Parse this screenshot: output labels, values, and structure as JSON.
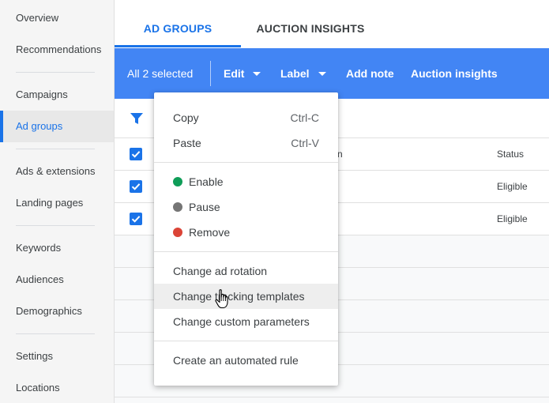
{
  "sidebar": {
    "items": [
      {
        "label": "Overview"
      },
      {
        "label": "Recommendations"
      },
      {
        "label": "Campaigns"
      },
      {
        "label": "Ad groups"
      },
      {
        "label": "Ads & extensions"
      },
      {
        "label": "Landing pages"
      },
      {
        "label": "Keywords"
      },
      {
        "label": "Audiences"
      },
      {
        "label": "Demographics"
      },
      {
        "label": "Settings"
      },
      {
        "label": "Locations"
      }
    ],
    "active_item": "Ad groups"
  },
  "tabs": [
    {
      "label": "AD GROUPS",
      "active": true
    },
    {
      "label": "AUCTION INSIGHTS",
      "active": false
    }
  ],
  "action_bar": {
    "selection_label": "All 2 selected",
    "edit_label": "Edit",
    "label_label": "Label",
    "add_note_label": "Add note",
    "auction_insights_label": "Auction insights"
  },
  "table": {
    "header_partial": "n",
    "status_header": "Status",
    "rows": [
      {
        "status": "Eligible",
        "checked": true
      },
      {
        "status": "Eligible",
        "checked": true
      }
    ]
  },
  "edit_menu": {
    "copy": {
      "label": "Copy",
      "shortcut": "Ctrl-C"
    },
    "paste": {
      "label": "Paste",
      "shortcut": "Ctrl-V"
    },
    "enable": {
      "label": "Enable",
      "icon": "green-dot-icon"
    },
    "pause": {
      "label": "Pause",
      "icon": "pause-dot-icon"
    },
    "remove": {
      "label": "Remove",
      "icon": "red-x-icon"
    },
    "change_ad_rotation": "Change ad rotation",
    "change_tracking_templates": "Change tracking templates",
    "change_custom_parameters": "Change custom parameters",
    "create_automated_rule": "Create an automated rule",
    "hovered_item": "Change tracking templates"
  },
  "colors": {
    "accent": "#1a73e8",
    "action_bar": "#4285f4",
    "enable": "#0f9d58",
    "pause": "#757575",
    "remove": "#db4437"
  }
}
